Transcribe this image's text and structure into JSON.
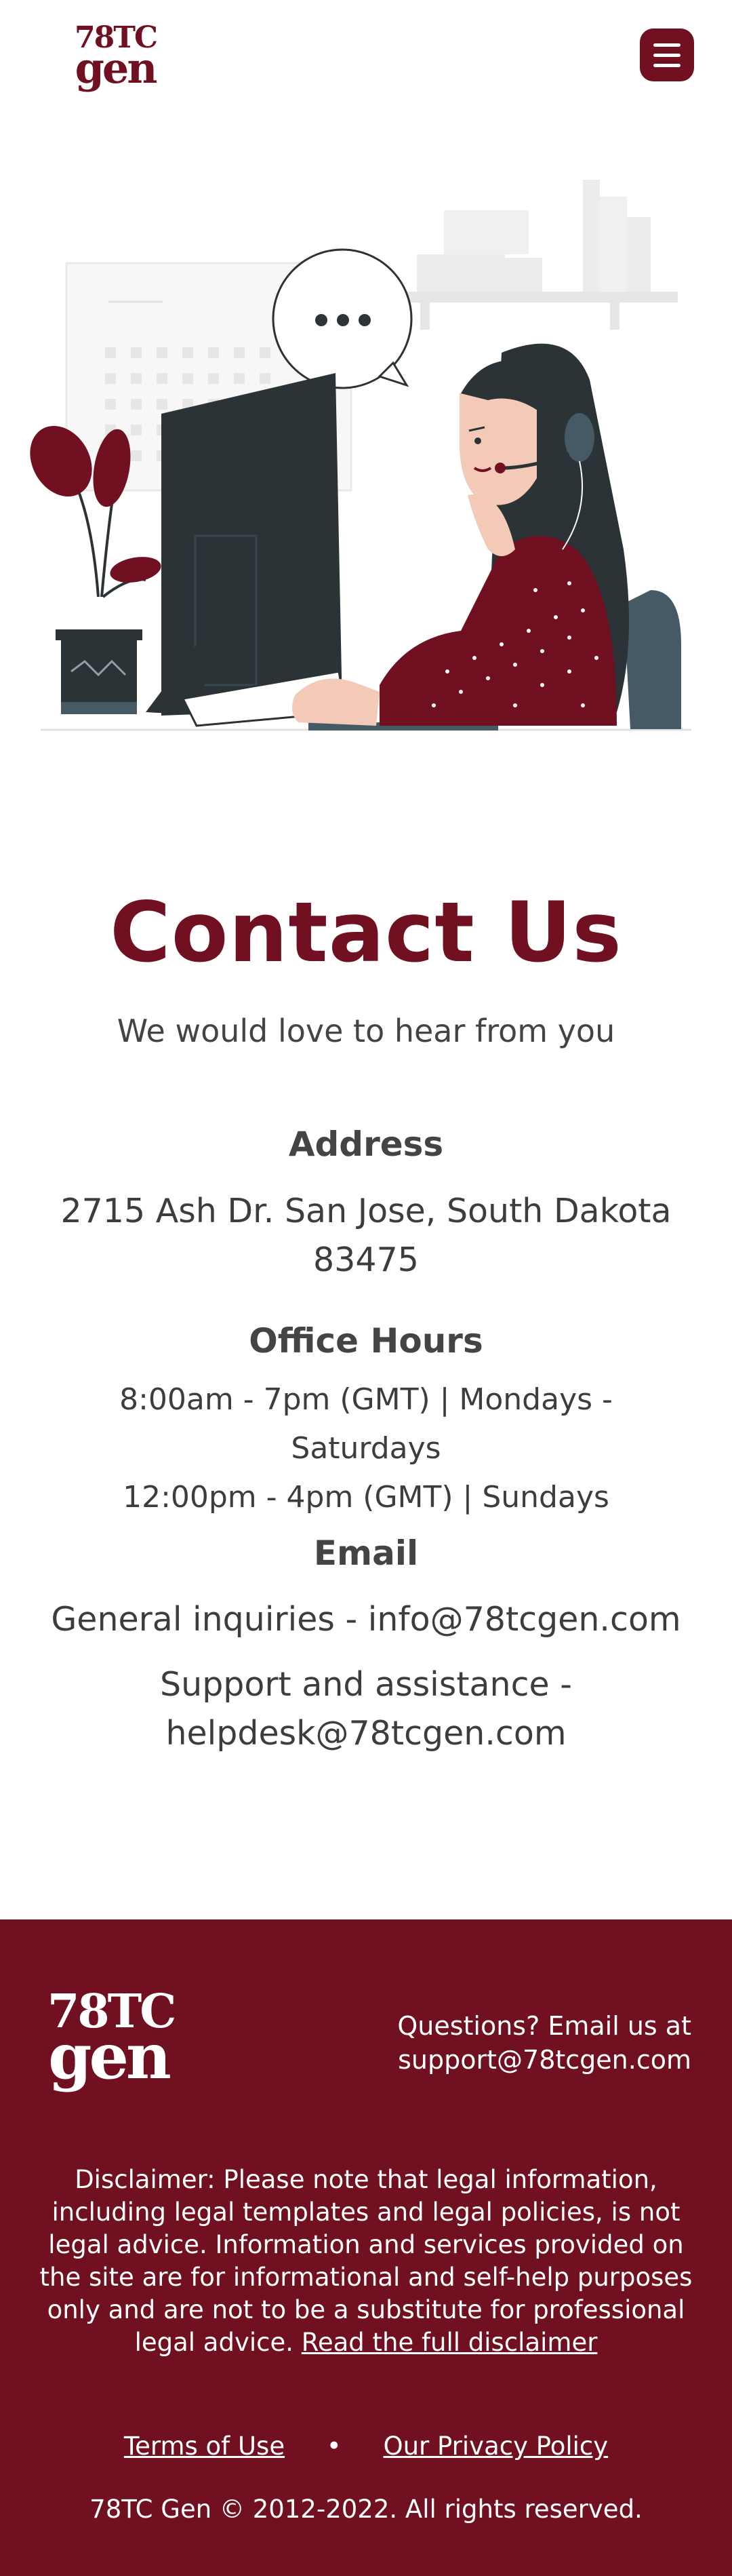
{
  "brand": {
    "logo_line1": "78TC",
    "logo_line2": "gen",
    "primary_color": "#701020"
  },
  "header": {
    "menu_icon": "hamburger-menu-icon"
  },
  "illustration": {
    "speech_bubble": "•••"
  },
  "contact": {
    "title": "Contact Us",
    "subtitle": "We would love to hear from you",
    "address_heading": "Address",
    "address_line1": "2715 Ash Dr. San Jose, South Dakota",
    "address_line2": "83475",
    "hours_heading": "Office Hours",
    "hours_line1": "8:00am - 7pm (GMT) | Mondays - Saturdays",
    "hours_line2": "12:00pm - 4pm (GMT) | Sundays",
    "email_heading": "Email",
    "email_general": "General inquiries - info@78tcgen.com",
    "email_support_line1": "Support and assistance -",
    "email_support_line2": "helpdesk@78tcgen.com"
  },
  "footer": {
    "questions_line1": "Questions? Email us at",
    "questions_line2": "support@78tcgen.com",
    "disclaimer_text": "Disclaimer: Please note that legal information, including legal templates and legal policies, is not legal advice. Information and services provided on the site are for informational and self-help purposes only and are not to be a substitute for professional legal advice.",
    "disclaimer_link": "Read the full disclaimer",
    "terms_link": "Terms of Use",
    "separator": "•",
    "privacy_link": "Our Privacy Policy",
    "copyright": "78TC Gen © 2012-2022. All rights reserved."
  }
}
